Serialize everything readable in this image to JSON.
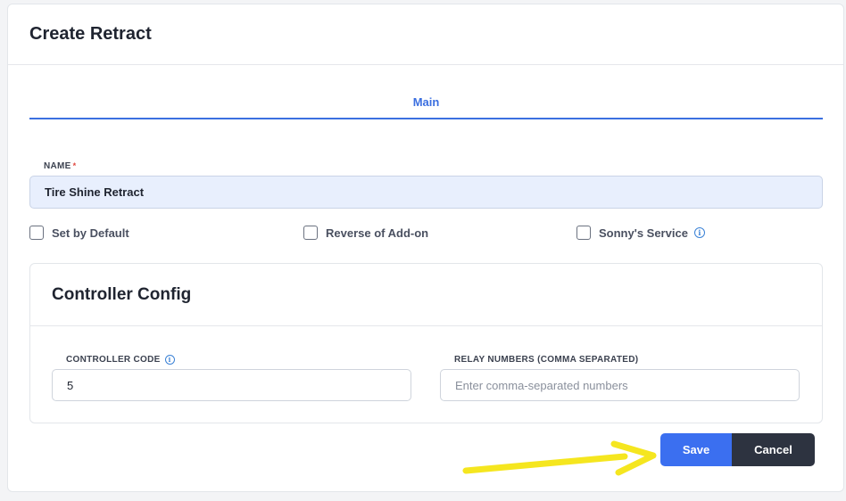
{
  "header": {
    "title": "Create Retract"
  },
  "tabs": [
    {
      "label": "Main",
      "active": true
    }
  ],
  "form": {
    "name_label": "NAME",
    "required_mark": "*",
    "name_value": "Tire Shine Retract",
    "checkboxes": [
      {
        "label": "Set by Default",
        "checked": false
      },
      {
        "label": "Reverse of Add-on",
        "checked": false
      },
      {
        "label": "Sonny's Service",
        "checked": false,
        "info_icon": "info-icon"
      }
    ]
  },
  "controller_config": {
    "title": "Controller Config",
    "controller_code_label": "CONTROLLER CODE",
    "controller_code_value": "5",
    "relay_numbers_label": "RELAY NUMBERS (COMMA SEPARATED)",
    "relay_numbers_value": "",
    "relay_numbers_placeholder": "Enter comma-separated numbers"
  },
  "actions": {
    "save_label": "Save",
    "cancel_label": "Cancel"
  },
  "colors": {
    "accent": "#3b6ff0",
    "cancel": "#2d3340",
    "annotation_arrow": "#f5e61f"
  }
}
